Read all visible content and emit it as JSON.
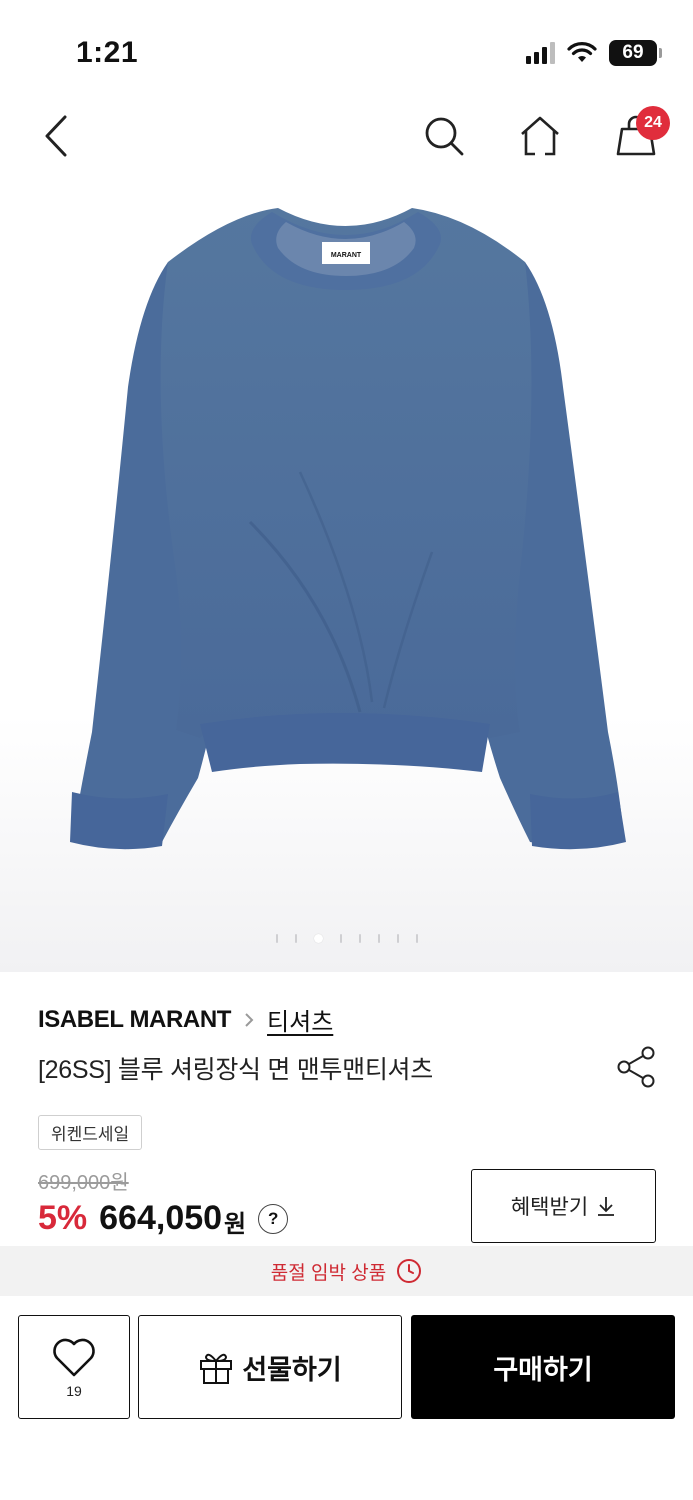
{
  "status_bar": {
    "time": "1:21",
    "battery": "69",
    "icons": [
      "signal-icon",
      "wifi-icon",
      "battery-icon"
    ]
  },
  "nav": {
    "cart_count": "24",
    "icons": [
      "back-icon",
      "search-icon",
      "home-icon",
      "shopping-bag-icon"
    ]
  },
  "gallery": {
    "image": "blue-sweatshirt-product-photo",
    "label_text": "MARANT",
    "image_count": 8,
    "active_index": 1
  },
  "product": {
    "brand": "ISABEL MARANT",
    "category": "티셔츠",
    "name": "[26SS] 블루 셔링장식 면 맨투맨티셔츠",
    "sale_tag": "위켄드세일",
    "original_price": "699,000원",
    "discount": "5%",
    "price": "664,050",
    "currency": "원",
    "help": "?"
  },
  "benefit_button": {
    "label": "혜택받기",
    "icon": "download-icon"
  },
  "notice": {
    "text": "품절 임박 상품",
    "icon": "clock-icon",
    "color": "#cf2a33"
  },
  "actions": {
    "like_count": "19",
    "gift_label": "선물하기",
    "buy_label": "구매하기"
  },
  "colors": {
    "accent_red": "#d8293a",
    "badge_red": "#e02d3c",
    "garment_blue": "#4e6f9f"
  }
}
